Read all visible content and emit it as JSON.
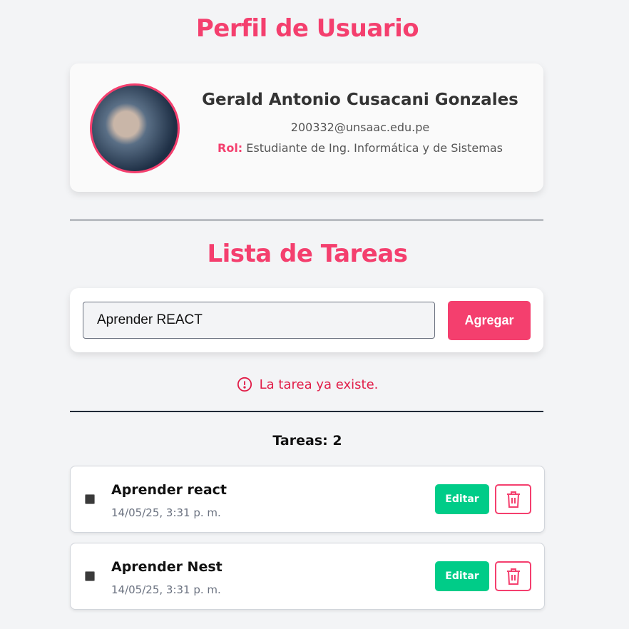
{
  "profile": {
    "title": "Perfil de Usuario",
    "name": "Gerald Antonio Cusacani Gonzales",
    "email": "200332@unsaac.edu.pe",
    "role_label": "Rol:",
    "role": "Estudiante de Ing. Informática y de Sistemas"
  },
  "tasks_section": {
    "title": "Lista de Tareas",
    "input_value": "Aprender REACT",
    "add_label": "Agregar",
    "error": "La tarea ya existe.",
    "count_label": "Tareas: 2"
  },
  "tasks": [
    {
      "title": "Aprender react",
      "date": "14/05/25, 3:31 p. m.",
      "edit_label": "Editar"
    },
    {
      "title": "Aprender Nest",
      "date": "14/05/25, 3:31 p. m.",
      "edit_label": "Editar"
    }
  ],
  "colors": {
    "accent": "#f43f6e",
    "edit": "#00cc88",
    "error": "#e11d48"
  }
}
